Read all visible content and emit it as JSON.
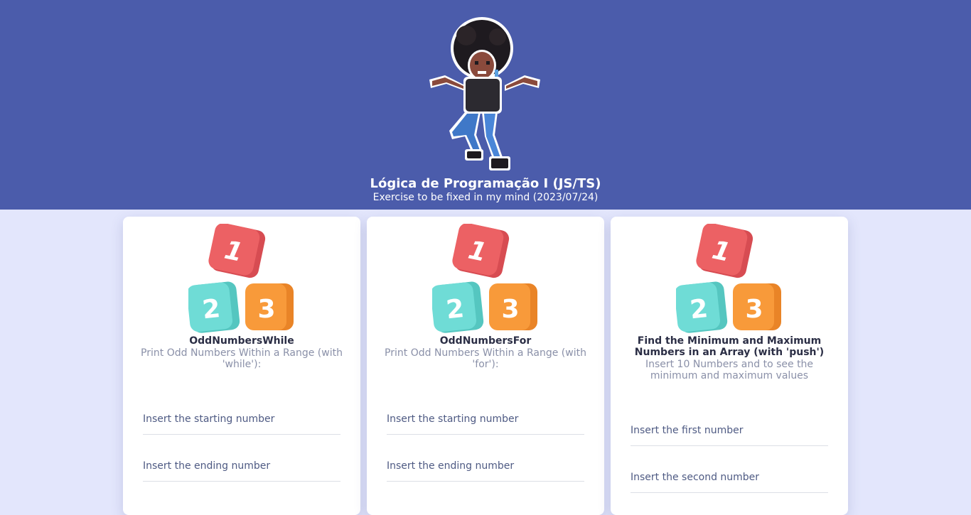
{
  "header": {
    "title": "Lógica de Programação I (JS/TS)",
    "subtitle": "Exercise to be fixed in my mind (2023/07/24)",
    "background": "#4b5cab"
  },
  "icons": {
    "avatar": "pixel-art-character-icon",
    "blocks": "number-blocks-icon"
  },
  "block_labels": [
    "1",
    "2",
    "3"
  ],
  "block_colors": {
    "one": "#ec6164",
    "two": "#6fdcd6",
    "three": "#f89a3a"
  },
  "cards": [
    {
      "title": "OddNumbersWhile",
      "description": "Print Odd Numbers Within a Range (with 'while'):",
      "fields": [
        {
          "placeholder": "Insert the starting number"
        },
        {
          "placeholder": "Insert the ending number"
        }
      ]
    },
    {
      "title": "OddNumbersFor",
      "description": "Print Odd Numbers Within a Range (with 'for'):",
      "fields": [
        {
          "placeholder": "Insert the starting number"
        },
        {
          "placeholder": "Insert the ending number"
        }
      ]
    },
    {
      "title": "Find the Minimum and Maximum Numbers in an Array (with 'push')",
      "description": "Insert 10 Numbers and to see the minimum and maximum values",
      "fields": [
        {
          "placeholder": "Insert the first number"
        },
        {
          "placeholder": "Insert the second number"
        }
      ]
    }
  ]
}
